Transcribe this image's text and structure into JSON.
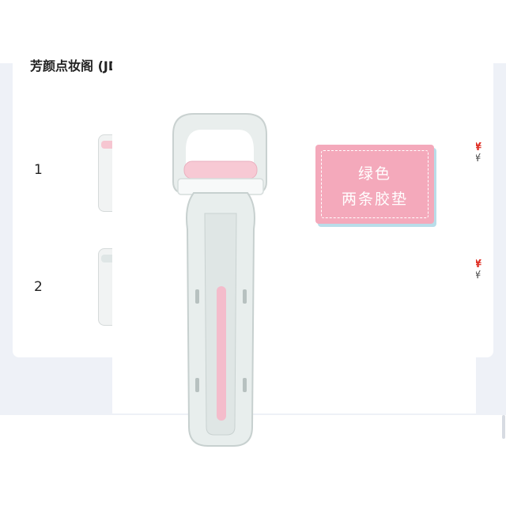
{
  "card": {
    "title": "芳颜点妆阁 (JD Bi",
    "rows": [
      {
        "index": "1",
        "price": "¥",
        "sub": "¥"
      },
      {
        "index": "2",
        "price": "¥",
        "sub": "¥"
      }
    ]
  },
  "product": {
    "tag_line1": "绿色",
    "tag_line2": "两条胶垫"
  },
  "colors": {
    "accent_pink": "#f4a9bb",
    "price_red": "#e0352b",
    "page_bg": "#eef1f7"
  }
}
